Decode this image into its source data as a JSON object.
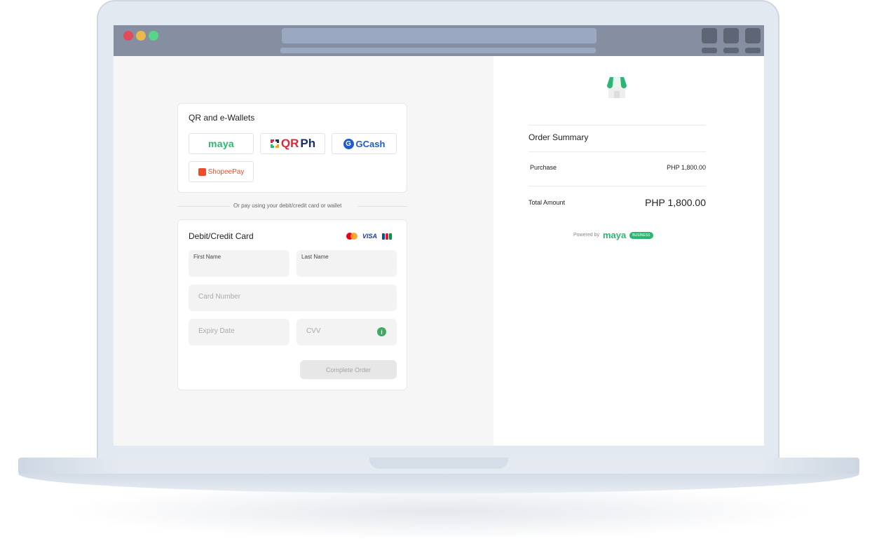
{
  "wallets": {
    "title": "QR and e-Wallets",
    "items": [
      {
        "label": "maya"
      },
      {
        "label_a": "QR",
        "label_b": "Ph"
      },
      {
        "label": "GCash"
      },
      {
        "label": "ShopeePay"
      }
    ]
  },
  "divider": {
    "text": "Or pay using your debit/credit card or wallet"
  },
  "card_form": {
    "title": "Debit/Credit Card",
    "visa_label": "VISA",
    "first_name_label": "First Name",
    "last_name_label": "Last Name",
    "card_number_placeholder": "Card Number",
    "expiry_placeholder": "Expiry Date",
    "cvv_placeholder": "CVV",
    "info_glyph": "i",
    "submit_label": "Complete Order"
  },
  "summary": {
    "title": "Order Summary",
    "purchase_label": "Purchase",
    "purchase_amount": "PHP 1,800.00",
    "total_label": "Total Amount",
    "total_amount": "PHP 1,800.00"
  },
  "powered_by": {
    "text": "Powered by",
    "brand": "maya",
    "badge": "BUSINESS"
  },
  "colors": {
    "maya_green": "#2bb673",
    "qr_red": "#e0253a",
    "gcash_blue": "#1f5ccc",
    "shopee_orange": "#ee4d2d"
  },
  "icons": [
    "store-icon",
    "mastercard-icon",
    "visa-icon",
    "jcb-icon",
    "info-icon",
    "gcash-icon",
    "shopee-bag-icon",
    "qr-icon"
  ]
}
